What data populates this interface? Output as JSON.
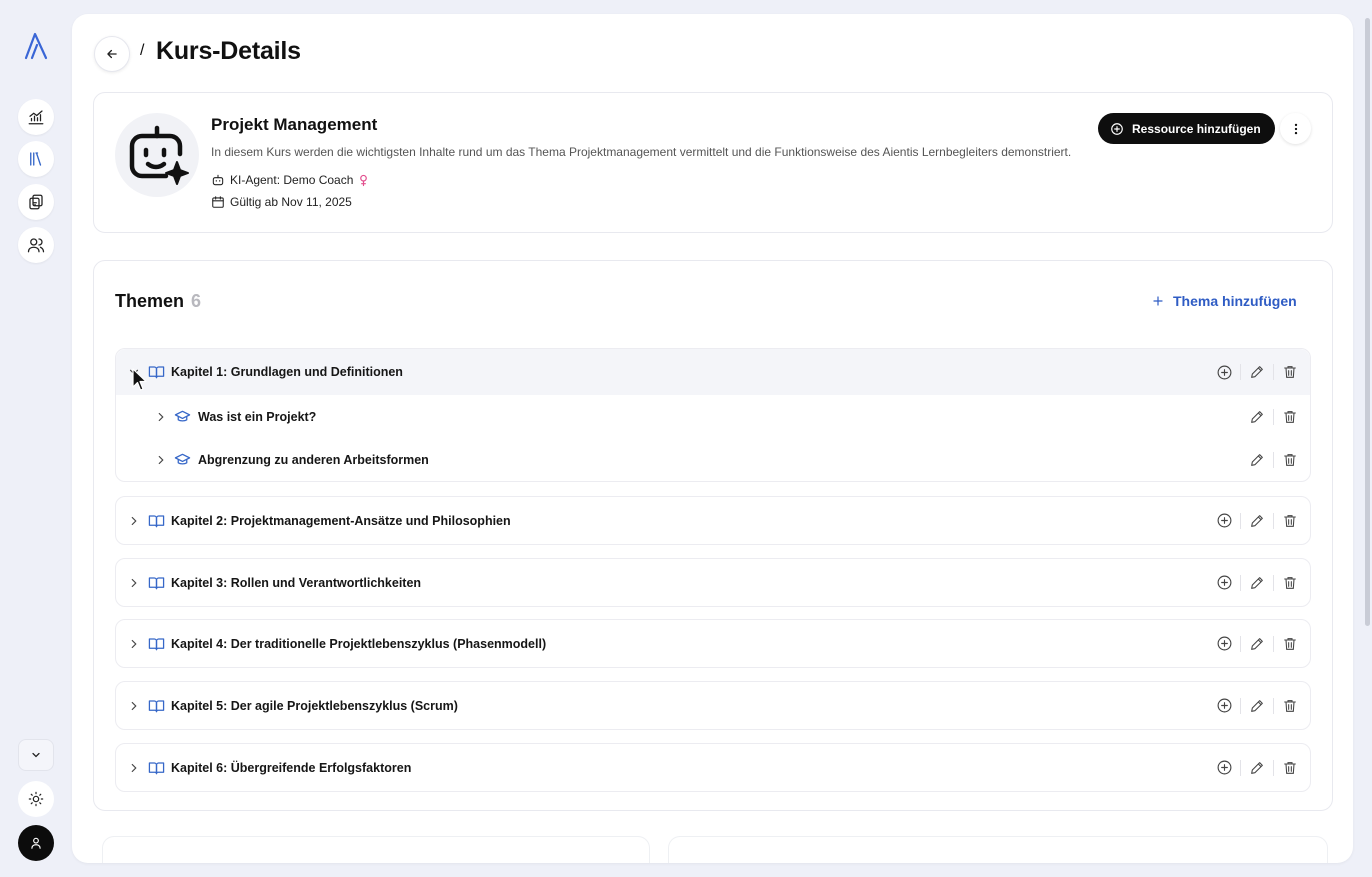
{
  "sidebar": {
    "logo": "aientis-logo",
    "nav": [
      {
        "icon": "chart-icon",
        "name": "analytics"
      },
      {
        "icon": "library-icon",
        "name": "courses",
        "active": true
      },
      {
        "icon": "copy-icon",
        "name": "resources"
      },
      {
        "icon": "users-icon",
        "name": "users"
      }
    ],
    "collapse_icon": "chevron-down-icon",
    "theme_icon": "sun-icon",
    "avatar_icon": "user-icon"
  },
  "header": {
    "separator": "/",
    "title": "Kurs-Details"
  },
  "course": {
    "title": "Projekt Management",
    "description": "In diesem Kurs werden die wichtigsten Inhalte rund um das Thema Projektmanagement vermittelt und die Funktionsweise des Aientis Lernbegleiters demonstriert.",
    "agent": "KI-Agent: Demo Coach",
    "valid": "Gültig ab Nov 11, 2025",
    "add_resource_label": "Ressource hinzufügen"
  },
  "topics": {
    "title": "Themen",
    "count": "6",
    "add_label": "Thema hinzufügen",
    "chapters": [
      {
        "label": "Kapitel 1: Grundlagen und Definitionen",
        "expanded": true,
        "subtopics": [
          "Was ist ein Projekt?",
          "Abgrenzung zu anderen Arbeitsformen"
        ]
      },
      {
        "label": "Kapitel 2: Projektmanagement-Ansätze und Philosophien"
      },
      {
        "label": "Kapitel 3: Rollen und Verantwortlichkeiten"
      },
      {
        "label": "Kapitel 4: Der traditionelle Projektlebenszyklus (Phasenmodell)"
      },
      {
        "label": "Kapitel 5: Der agile Projektlebenszyklus (Scrum)"
      },
      {
        "label": "Kapitel 6: Übergreifende Erfolgsfaktoren"
      }
    ]
  },
  "colors": {
    "accent": "#2f5cc4",
    "icon_blue": "#3667c8",
    "dark": "#0e0e0e",
    "background": "#eef0f8"
  }
}
